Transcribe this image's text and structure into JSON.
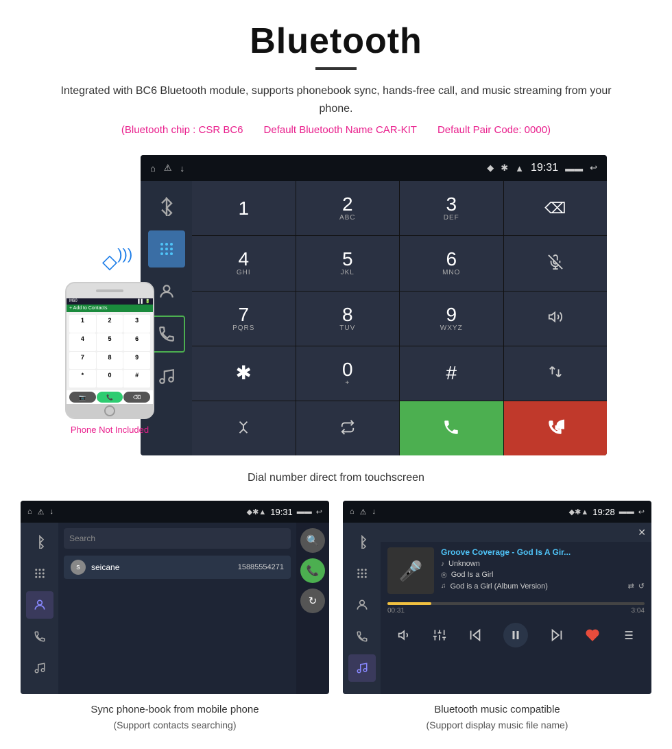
{
  "header": {
    "title": "Bluetooth",
    "description": "Integrated with BC6 Bluetooth module, supports phonebook sync, hands-free call, and music streaming from your phone.",
    "spec1": "(Bluetooth chip : CSR BC6",
    "spec2": "Default Bluetooth Name CAR-KIT",
    "spec3": "Default Pair Code: 0000)",
    "underline": true
  },
  "status_bar": {
    "time": "19:31",
    "icons_left": "⌂ ⚠ ↓",
    "icons_right": "♦ ✱ ▲ 19:31 🔋 ↩"
  },
  "dialpad": {
    "keys": [
      {
        "num": "1",
        "letters": ""
      },
      {
        "num": "2",
        "letters": "ABC"
      },
      {
        "num": "3",
        "letters": "DEF"
      },
      {
        "num": "⌫",
        "letters": ""
      },
      {
        "num": "4",
        "letters": "GHI"
      },
      {
        "num": "5",
        "letters": "JKL"
      },
      {
        "num": "6",
        "letters": "MNO"
      },
      {
        "num": "🎤",
        "letters": ""
      },
      {
        "num": "7",
        "letters": "PQRS"
      },
      {
        "num": "8",
        "letters": "TUV"
      },
      {
        "num": "9",
        "letters": "WXYZ"
      },
      {
        "num": "🔊",
        "letters": ""
      },
      {
        "num": "✱",
        "letters": ""
      },
      {
        "num": "0",
        "letters": "+"
      },
      {
        "num": "#",
        "letters": ""
      },
      {
        "num": "⇅",
        "letters": ""
      },
      {
        "num": "✦",
        "letters": ""
      },
      {
        "num": "⇄",
        "letters": ""
      },
      {
        "num": "📞",
        "letters": ""
      },
      {
        "num": "📵",
        "letters": ""
      }
    ]
  },
  "caption_main": "Dial number direct from touchscreen",
  "phone": {
    "not_included": "Phone Not Included",
    "keys": [
      "1",
      "2",
      "3",
      "4",
      "5",
      "6",
      "7",
      "8",
      "9",
      "*",
      "0",
      "#"
    ]
  },
  "phonebook": {
    "search_placeholder": "Search",
    "contact_name": "seicane",
    "contact_number": "15885554271",
    "contact_initial": "s",
    "caption": "Sync phone-book from mobile phone",
    "caption_sub": "(Support contacts searching)"
  },
  "music": {
    "song_title": "Groove Coverage - God Is A Gir...",
    "artist": "Unknown",
    "album": "God Is a Girl",
    "track": "God is a Girl (Album Version)",
    "time_current": "00:31",
    "time_total": "3:04",
    "progress_pct": 17,
    "caption": "Bluetooth music compatible",
    "caption_sub": "(Support display music file name)"
  },
  "mini_status1": {
    "time": "19:31"
  },
  "mini_status2": {
    "time": "19:28"
  }
}
